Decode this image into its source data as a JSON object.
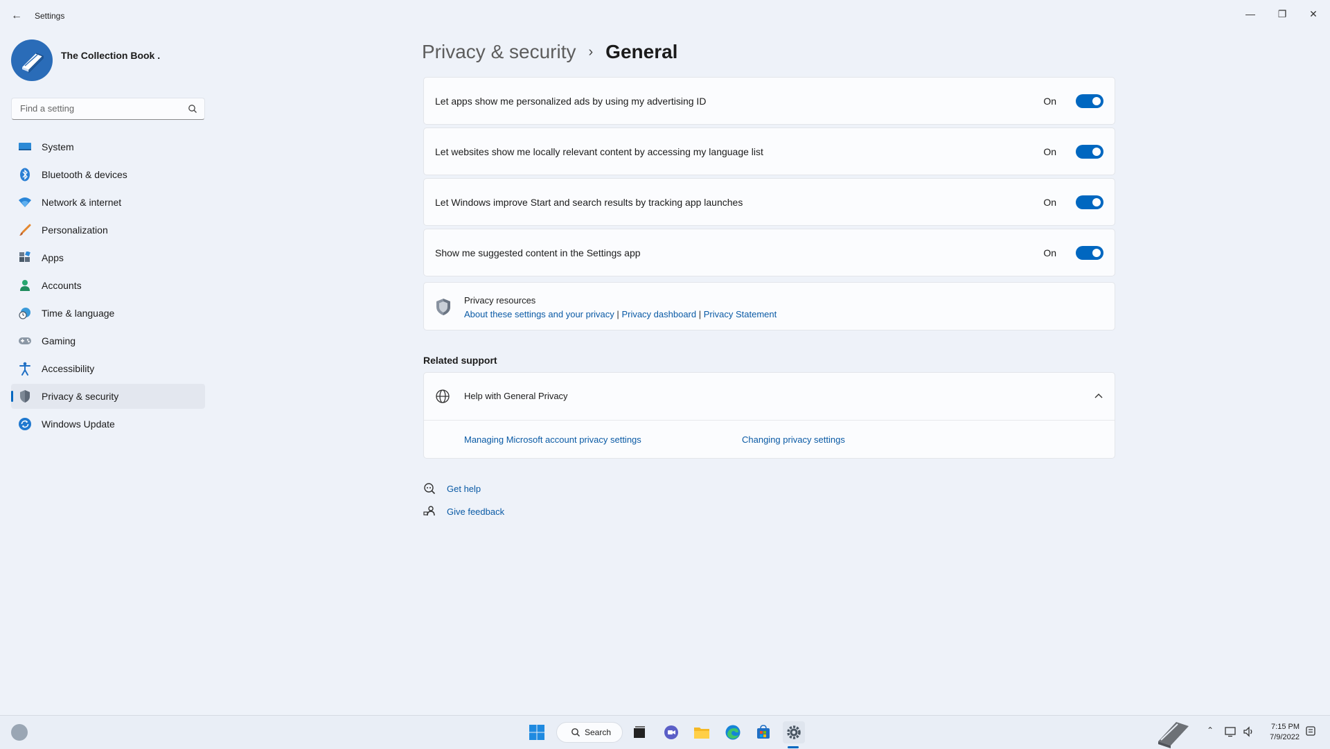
{
  "window": {
    "app_title": "Settings",
    "controls": [
      "minimize",
      "restore",
      "close"
    ]
  },
  "profile": {
    "name": "The Collection Book ."
  },
  "search": {
    "placeholder": "Find a setting"
  },
  "sidebar": {
    "items": [
      {
        "label": "System",
        "icon": "monitor-icon"
      },
      {
        "label": "Bluetooth & devices",
        "icon": "bluetooth-icon"
      },
      {
        "label": "Network & internet",
        "icon": "wifi-icon"
      },
      {
        "label": "Personalization",
        "icon": "brush-icon"
      },
      {
        "label": "Apps",
        "icon": "apps-icon"
      },
      {
        "label": "Accounts",
        "icon": "person-icon"
      },
      {
        "label": "Time & language",
        "icon": "clock-globe-icon"
      },
      {
        "label": "Gaming",
        "icon": "gamepad-icon"
      },
      {
        "label": "Accessibility",
        "icon": "accessibility-icon"
      },
      {
        "label": "Privacy & security",
        "icon": "shield-icon",
        "active": true
      },
      {
        "label": "Windows Update",
        "icon": "update-icon"
      }
    ]
  },
  "breadcrumb": {
    "parent": "Privacy & security",
    "separator": "›",
    "current": "General"
  },
  "settings": [
    {
      "label": "Let apps show me personalized ads by using my advertising ID",
      "state": "On"
    },
    {
      "label": "Let websites show me locally relevant content by accessing my language list",
      "state": "On"
    },
    {
      "label": "Let Windows improve Start and search results by tracking app launches",
      "state": "On"
    },
    {
      "label": "Show me suggested content in the Settings app",
      "state": "On"
    }
  ],
  "privacy_resources": {
    "title": "Privacy resources",
    "links": [
      "About these settings and your privacy",
      "Privacy dashboard",
      "Privacy Statement"
    ],
    "divider": "|"
  },
  "related_support": {
    "heading": "Related support",
    "help": {
      "title": "Help with General Privacy",
      "links": [
        "Managing Microsoft account privacy settings",
        "Changing privacy settings"
      ]
    }
  },
  "aux_links": {
    "get_help": "Get help",
    "give_feedback": "Give feedback"
  },
  "taskbar": {
    "search_label": "Search",
    "time": "7:15 PM",
    "date": "7/9/2022"
  },
  "colors": {
    "accent": "#0067c0",
    "link": "#0a5aa5",
    "background": "#eef2f9"
  }
}
